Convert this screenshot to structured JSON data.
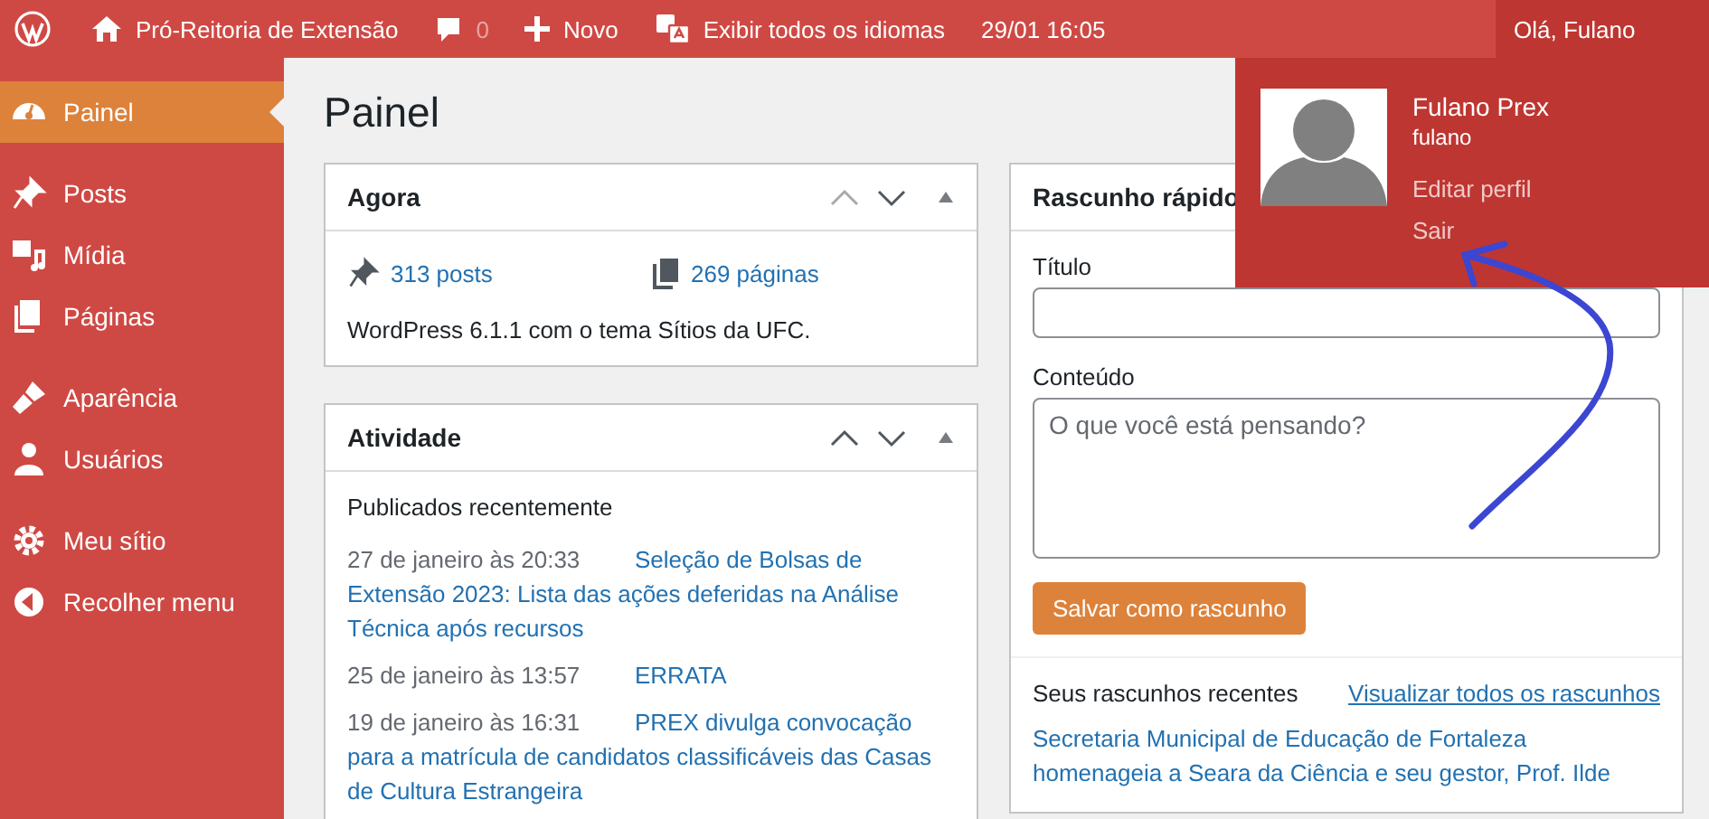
{
  "admin_bar": {
    "items": [
      {
        "kind": "logo"
      },
      {
        "kind": "site",
        "label": "Pró-Reitoria de Extensão"
      },
      {
        "kind": "comments",
        "label": "0"
      },
      {
        "kind": "new",
        "label": "Novo"
      },
      {
        "kind": "languages",
        "label": "Exibir todos os idiomas"
      },
      {
        "kind": "clock",
        "label": "29/01 16:05"
      }
    ],
    "account": {
      "greeting": "Olá, Fulano",
      "open": true,
      "menu": {
        "display_name": "Fulano Prex",
        "username": "fulano",
        "links": [
          "Editar perfil",
          "Sair"
        ]
      }
    }
  },
  "sidebar": {
    "groups": [
      {
        "items": [
          {
            "kind": "dashboard",
            "label": "Painel",
            "selected": true
          }
        ]
      },
      {
        "items": [
          {
            "kind": "posts",
            "label": "Posts",
            "selected": false
          },
          {
            "kind": "media",
            "label": "Mídia",
            "selected": false
          },
          {
            "kind": "pages",
            "label": "Páginas",
            "selected": false
          }
        ]
      },
      {
        "items": [
          {
            "kind": "appearance",
            "label": "Aparência",
            "selected": false
          },
          {
            "kind": "users",
            "label": "Usuários",
            "selected": false
          }
        ]
      },
      {
        "items": [
          {
            "kind": "settings",
            "label": "Meu sítio",
            "selected": false
          },
          {
            "kind": "collapse",
            "label": "Recolher menu",
            "selected": false
          }
        ]
      }
    ]
  },
  "page_title": "Painel",
  "at_a_glance": {
    "title": "Agora",
    "can_move_up": false,
    "counts": [
      {
        "kind": "posts",
        "label": "313 posts"
      },
      {
        "kind": "pages",
        "label": "269 páginas"
      }
    ],
    "footer": "WordPress 6.1.1 com o tema Sítios da UFC."
  },
  "activity": {
    "title": "Atividade",
    "can_move_up": true,
    "subtitle": "Publicados recentemente",
    "rows": [
      {
        "date": "27 de janeiro às 20:33",
        "title": "Seleção de Bolsas de Extensão 2023: Lista das ações deferidas na Análise Técnica após recursos"
      },
      {
        "date": "25 de janeiro às 13:57",
        "title": "ERRATA"
      },
      {
        "date": "19 de janeiro às 16:31",
        "title": "PREX divulga convocação para a matrícula de candidatos classificáveis das Casas de Cultura Estrangeira"
      }
    ]
  },
  "quick_draft": {
    "title": "Rascunho rápido",
    "title_label": "Título",
    "content_label": "Conteúdo",
    "content_placeholder": "O que você está pensando?",
    "button": "Salvar como rascunho",
    "drafts_heading": "Seus rascunhos recentes",
    "drafts_link": "Visualizar todos os rascunhos",
    "drafts": [
      {
        "title": "Secretaria Municipal de Educação de Fortaleza homenageia a Seara da Ciência e seu gestor, Prof. Ilde"
      }
    ]
  },
  "annotation": {
    "kind": "arrow"
  }
}
